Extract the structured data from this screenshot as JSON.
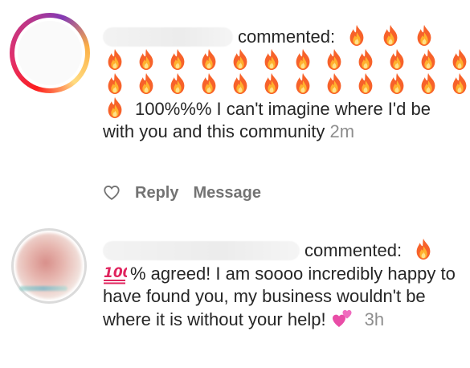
{
  "comments": [
    {
      "verb": "commented:",
      "leading_fire_count": 3,
      "fire_rows": [
        12,
        12
      ],
      "text": "100%%% I can't imagine where I'd be with you and this community",
      "time": "2m",
      "actions": {
        "like_icon": "heart-outline-icon",
        "reply_label": "Reply",
        "message_label": "Message"
      }
    },
    {
      "verb": "commented:",
      "leading_fire_count": 1,
      "prefix_emoji": "100-emoji",
      "text": "% agreed! I am soooo incredibly happy to have found you, my business wouldn't be where it is without your help!",
      "trailing_emoji": "two-hearts-emoji",
      "time": "3h"
    }
  ],
  "colors": {
    "fire": "#ff5a1f",
    "timestamp": "#8e8e8e",
    "action": "#737373",
    "text": "#262626"
  }
}
